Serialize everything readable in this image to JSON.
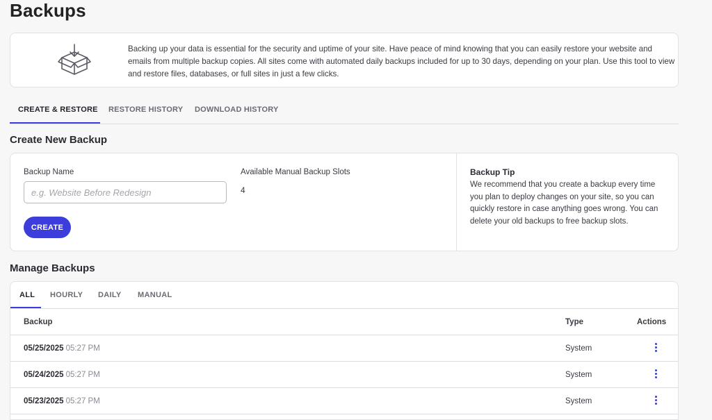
{
  "page": {
    "title": "Backups"
  },
  "info": {
    "icon": "box-download-icon",
    "text": "Backing up your data is essential for the security and uptime of your site. Have peace of mind knowing that you can easily restore your website and emails from multiple backup copies. All sites come with automated daily backups included for up to 30 days, depending on your plan. Use this tool to view and restore files, databases, or full sites in just a few clicks."
  },
  "tabs": [
    {
      "label": "CREATE & RESTORE",
      "active": true
    },
    {
      "label": "RESTORE HISTORY",
      "active": false
    },
    {
      "label": "DOWNLOAD HISTORY",
      "active": false
    }
  ],
  "create": {
    "section_title": "Create New Backup",
    "name_label": "Backup Name",
    "name_placeholder": "e.g. Website Before Redesign",
    "name_value": "",
    "slots_label": "Available Manual Backup Slots",
    "slots_value": "4",
    "button_label": "CREATE",
    "tip_title": "Backup Tip",
    "tip_text": "We recommend that you create a backup every time you plan to deploy changes on your site, so you can quickly restore in case anything goes wrong. You can delete your old backups to free backup slots."
  },
  "manage": {
    "section_title": "Manage Backups",
    "filters": [
      {
        "label": "ALL",
        "active": true
      },
      {
        "label": "HOURLY",
        "active": false
      },
      {
        "label": "DAILY",
        "active": false
      },
      {
        "label": "MANUAL",
        "active": false
      }
    ],
    "columns": {
      "backup": "Backup",
      "type": "Type",
      "actions": "Actions"
    },
    "rows": [
      {
        "date": "05/25/2025",
        "time": "05:27 PM",
        "type": "System"
      },
      {
        "date": "05/24/2025",
        "time": "05:27 PM",
        "type": "System"
      },
      {
        "date": "05/23/2025",
        "time": "05:27 PM",
        "type": "System"
      }
    ]
  },
  "colors": {
    "accent": "#3d3ddb",
    "border": "#e2e2e6",
    "background": "#f7f7f8"
  }
}
